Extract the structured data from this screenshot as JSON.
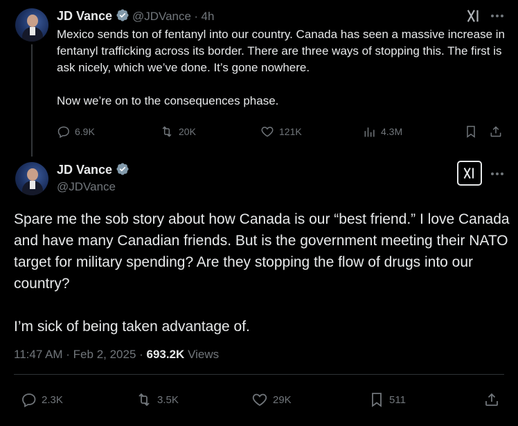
{
  "tweet1": {
    "author_name": "JD Vance",
    "handle": "@JDVance",
    "separator": "·",
    "time": "4h",
    "text": "Mexico sends ton of fentanyl into our country. Canada has seen a massive increase in fentanyl trafficking across its border. There are three ways of stopping this. The first is ask nicely, which we’ve done. It’s gone nowhere.\n\nNow we’re on to the consequences phase.",
    "replies": "6.9K",
    "reposts": "20K",
    "likes": "121K",
    "views": "4.3M"
  },
  "tweet2": {
    "author_name": "JD Vance",
    "handle": "@JDVance",
    "text": "Spare me the sob story about how Canada is our “best friend.” I love Canada and have many Canadian friends. But is the government meeting their NATO target for military spending? Are they stopping the flow of drugs into our country?\n\nI’m sick of being taken advantage of.",
    "timestamp": "11:47 AM · Feb 2, 2025 · ",
    "view_count": "693.2K",
    "views_label": "Views",
    "replies": "2.3K",
    "reposts": "3.5K",
    "likes": "29K",
    "bookmarks": "511"
  },
  "icons": {
    "verified": "verified-badge-icon",
    "grok": "grok-icon",
    "more": "more-icon",
    "reply": "reply-icon",
    "repost": "repost-icon",
    "like": "like-icon",
    "views": "views-icon",
    "bookmark": "bookmark-icon",
    "share": "share-icon"
  },
  "colors": {
    "background": "#000000",
    "text": "#e7e9ea",
    "muted": "#71767b",
    "verified": "#829aab"
  }
}
